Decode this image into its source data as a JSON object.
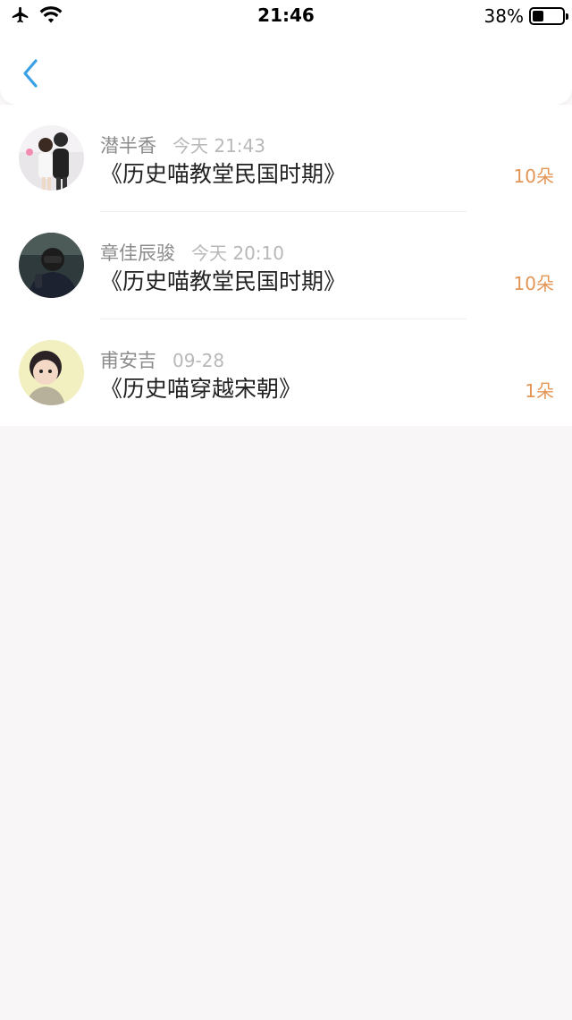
{
  "status_bar": {
    "time": "21:46",
    "battery_percent_label": "38%",
    "battery_level": 0.38,
    "icons": [
      "airplane-icon",
      "wifi-icon",
      "battery-icon"
    ]
  },
  "nav": {
    "back_icon": "chevron-left-icon",
    "accent_color": "#3aa0e6"
  },
  "list": {
    "items": [
      {
        "name": "潜半香",
        "time": "今天 21:43",
        "title": "《历史喵教堂民国时期》",
        "count": "10朵"
      },
      {
        "name": "章佳辰骏",
        "time": "今天 20:10",
        "title": "《历史喵教堂民国时期》",
        "count": "10朵"
      },
      {
        "name": "甫安吉",
        "time": "09-28",
        "title": "《历史喵穿越宋朝》",
        "count": "1朵"
      }
    ],
    "count_color": "#e39556"
  }
}
